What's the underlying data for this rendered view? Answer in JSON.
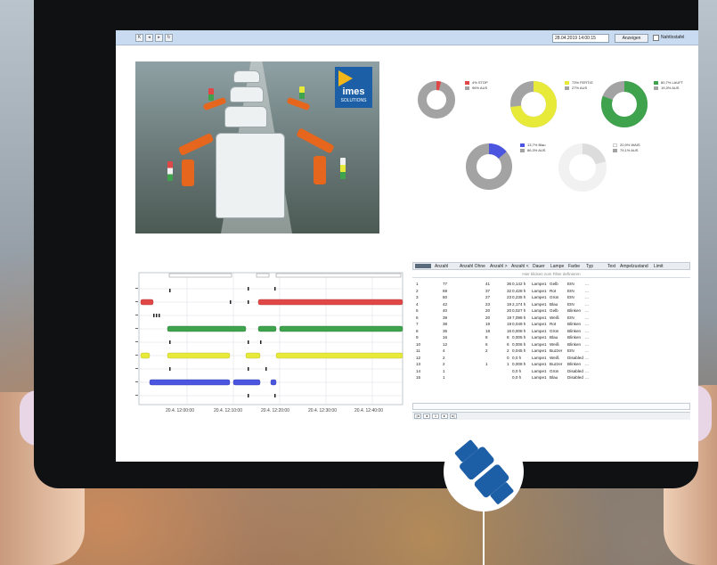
{
  "toolbar": {
    "nav_buttons": [
      "K",
      "◂",
      "▸",
      "↻"
    ],
    "datetime": "28.04.2019 14:00:15",
    "show_label": "Anzeigen",
    "checkbox_label": "Nahtlostafel"
  },
  "logo": {
    "name": "imes",
    "sub": "SOLUTIONS"
  },
  "donuts": [
    {
      "on_label": "4% STOP",
      "off_label": "96% AUS",
      "on_fraction": 0.04,
      "color": "#e04848"
    },
    {
      "on_label": "73% FERTIG",
      "off_label": "27% AUS",
      "on_fraction": 0.73,
      "color": "#e8ea3a"
    },
    {
      "on_label": "80,7% LAUFT",
      "off_label": "19,3% AUS",
      "on_fraction": 0.807,
      "color": "#3fa34d"
    },
    {
      "on_label": "13,7% Blau",
      "off_label": "86,3% AUS",
      "on_fraction": 0.137,
      "color": "#4b55e0"
    },
    {
      "on_label": "20,9% WAIS",
      "off_label": "79,1% AUS",
      "on_fraction": 0.209,
      "color": "#e6e6e6"
    }
  ],
  "colors": {
    "off": "#a3a3a3",
    "header_blue": "#c8dbf0",
    "red": "#e04848",
    "green": "#3fa34d",
    "yellow": "#e8ea3a",
    "blue": "#4b55e0"
  },
  "timeline": {
    "x_ticks": [
      "20.4. 12:00:00",
      "20.4. 12:10:00",
      "20.4. 12:20:00",
      "20.4. 12:30:00",
      "20.4. 12:40:00"
    ]
  },
  "table": {
    "headers": [
      "",
      "Anzahl",
      "Anzahl Ohne",
      "Anzahl >",
      "Anzahl <",
      "Dauer",
      "Lampe",
      "Farbe",
      "Typ",
      "Text",
      "Ampelzustand",
      "Limit"
    ],
    "filter_hint": "Hier klicken zum Filter definieren",
    "rows": [
      [
        "1",
        "77",
        "41",
        "36",
        "0,142 h",
        "Lampe1",
        "Gelb",
        "EIN",
        "..."
      ],
      [
        "2",
        "69",
        "37",
        "32",
        "0,428 h",
        "Lampe1",
        "Rot",
        "EIN",
        "..."
      ],
      [
        "3",
        "50",
        "27",
        "23",
        "0,235 h",
        "Lampe1",
        "Grün",
        "EIN",
        "..."
      ],
      [
        "4",
        "42",
        "23",
        "19",
        "2,174 h",
        "Lampe1",
        "Blau",
        "EIN",
        "..."
      ],
      [
        "5",
        "40",
        "20",
        "20",
        "0,027 h",
        "Lampe1",
        "Gelb",
        "Blinken",
        "..."
      ],
      [
        "6",
        "39",
        "20",
        "19",
        "7,098 h",
        "Lampe1",
        "Weiß",
        "EIN",
        "..."
      ],
      [
        "7",
        "38",
        "19",
        "19",
        "0,049 h",
        "Lampe1",
        "Rot",
        "Blinken",
        "..."
      ],
      [
        "8",
        "35",
        "18",
        "16",
        "0,008 h",
        "Lampe1",
        "Grün",
        "Blinken",
        "..."
      ],
      [
        "9",
        "16",
        "8",
        "8",
        "0,005 h",
        "Lampe1",
        "Blau",
        "Blinken",
        "..."
      ],
      [
        "10",
        "12",
        "6",
        "6",
        "0,006 h",
        "Lampe1",
        "Weiß",
        "Blinken",
        "..."
      ],
      [
        "11",
        "4",
        "2",
        "2",
        "0,045 h",
        "Lampe1",
        "Buzzer",
        "EIN",
        "..."
      ],
      [
        "12",
        "2",
        "",
        "0",
        "0,0 h",
        "Lampe1",
        "Weiß",
        "Disabled",
        "..."
      ],
      [
        "13",
        "2",
        "1",
        "1",
        "0,008 h",
        "Lampe1",
        "Buzzer",
        "Blinken",
        "..."
      ],
      [
        "14",
        "1",
        "",
        "",
        "0,0 h",
        "Lampe1",
        "Grün",
        "Disabled",
        "..."
      ],
      [
        "15",
        "1",
        "",
        "",
        "0,0 h",
        "Lampe1",
        "Blau",
        "Disabled",
        "..."
      ]
    ],
    "pager": [
      "|◂",
      "◂",
      "1",
      "▸",
      "▸|"
    ]
  }
}
